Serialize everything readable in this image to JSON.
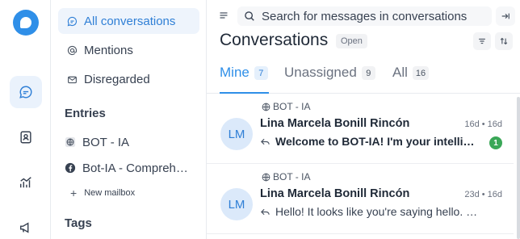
{
  "sidebar": {
    "items": [
      {
        "label": "All conversations",
        "icon": "chat-bubble-icon",
        "active": true
      },
      {
        "label": "Mentions",
        "icon": "at-icon"
      },
      {
        "label": "Disregarded",
        "icon": "mail-open-icon"
      }
    ],
    "entries_title": "Entries",
    "inboxes": [
      {
        "label": "BOT - IA",
        "icon": "globe-icon"
      },
      {
        "label": "Bot-IA - Compreh…",
        "icon": "facebook-icon"
      }
    ],
    "new_mailbox": "New mailbox",
    "tags_title": "Tags"
  },
  "search": {
    "placeholder": "Search for messages in conversations"
  },
  "header": {
    "title": "Conversations",
    "status": "Open"
  },
  "tabs": [
    {
      "label": "Mine",
      "count": "7",
      "active": true
    },
    {
      "label": "Unassigned",
      "count": "9"
    },
    {
      "label": "All",
      "count": "16"
    }
  ],
  "conversations": [
    {
      "inbox": "BOT - IA",
      "avatar": "LM",
      "name": "Lina Marcela Bonill Rincón",
      "time": "16d • 16d",
      "message": "Welcome to BOT-IA! I'm your intelligent assistant",
      "unread": "1"
    },
    {
      "inbox": "BOT - IA",
      "avatar": "LM",
      "name": "Lina Marcela Bonill Rincón",
      "time": "23d • 16d",
      "message": "Hello! It looks like you're saying hello. How can I help you?"
    }
  ],
  "colors": {
    "accent": "#2f8fe8",
    "unread": "#3aa757"
  }
}
